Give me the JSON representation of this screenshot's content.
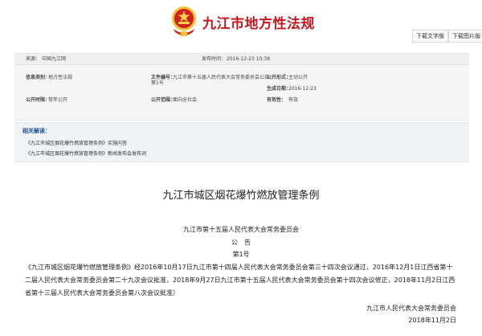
{
  "header": {
    "site_title": "九江市地方性法规",
    "download_word": "下载文字版",
    "download_pdf": "下载图片版"
  },
  "meta": {
    "source_label": "来源：",
    "source_value": "中国九江网",
    "pub_time_label": "发布时间：",
    "pub_time_value": "2016-12-23 10:38",
    "category_label": "信息类别：",
    "category_value": "地方性法规",
    "doc_no_label": "文件编号：",
    "doc_no_value_1": "九江市第十五届人民代表大会常务委员会公告",
    "doc_no_value_2": "第1号",
    "open_form_label": "公开形式：",
    "open_form_value": "主动公开",
    "gen_date_label": "生成日期：",
    "gen_date_value": "2016-12-23",
    "open_period_label": "公开时限：",
    "open_period_value": "常年公开",
    "open_scope_label": "公开范围：",
    "open_scope_value": "面向全社会",
    "validity_label": "有效性：",
    "validity_value": "有效"
  },
  "related": {
    "title": "相关解读：",
    "links": [
      "《九江市城区烟花爆竹燃放管理条例》实施问答",
      "《九江市城区烟花爆竹燃放管理条例》新闻发布会发布词"
    ]
  },
  "article": {
    "title": "九江市城区烟花爆竹燃放管理条例",
    "issuer": "九江市第十五届人民代表大会常务委员会",
    "notice": "公　告",
    "number": "第1号",
    "body": "《九江市城区烟花爆竹燃放管理条例》经2016年10月17日九江市第十四届人民代表大会常务委员会第三十四次会议通过，2016年12月1日江西省第十二届人民代表大会常务委员会第二十九次会议批准，2018年9月27日九江市第十五届人民代表大会常务委员会第十四次会议修正，2018年11月2日江西省第十三届人民代表大会常务委员会第八次会议批准）",
    "signature": "九江市人民代表大会常务委员会",
    "date": "2018年11月2日"
  }
}
